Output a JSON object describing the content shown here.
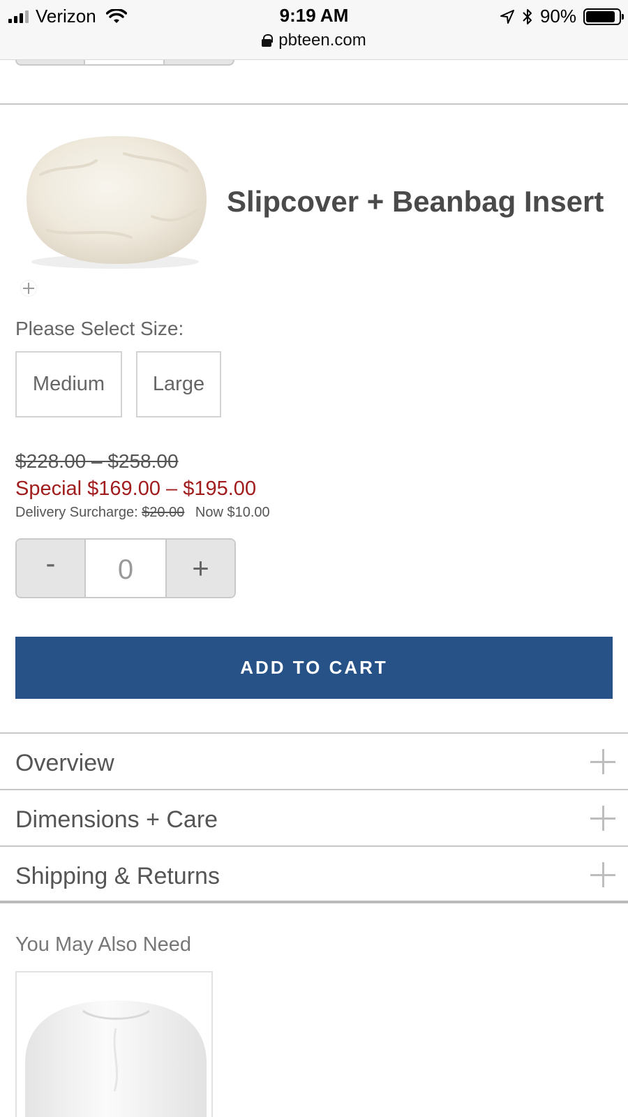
{
  "status_bar": {
    "carrier": "Verizon",
    "time": "9:19 AM",
    "battery": "90%",
    "battery_level": 0.9,
    "url": "pbteen.com"
  },
  "product": {
    "title": "Slipcover + Beanbag Insert",
    "size_label": "Please Select Size:",
    "sizes": [
      "Medium",
      "Large"
    ],
    "price_original": "$228.00 – $258.00",
    "price_special": "Special $169.00 – $195.00",
    "surcharge_label": "Delivery Surcharge:",
    "surcharge_old": "$20.00",
    "surcharge_now": "Now $10.00",
    "qty_minus": "-",
    "qty_plus": "+",
    "quantity": "0",
    "add_to_cart": "ADD TO CART"
  },
  "accordion": {
    "items": [
      "Overview",
      "Dimensions + Care",
      "Shipping & Returns"
    ]
  },
  "recommendations": {
    "heading": "You May Also Need"
  },
  "colors": {
    "accent": "#275288",
    "special_price": "#a11c1c"
  }
}
